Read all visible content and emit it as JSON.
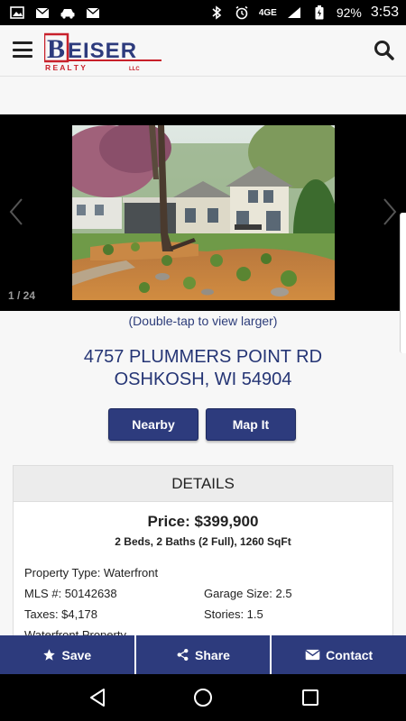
{
  "status_bar": {
    "network_label": "4GE",
    "battery_percent": "92%",
    "time": "3:53"
  },
  "header": {
    "logo_main": "EISER",
    "logo_initial": "B",
    "logo_sub": "R E A L T Y",
    "logo_llc": "LLC"
  },
  "gallery": {
    "counter": "1 / 24",
    "double_tap_hint": "(Double-tap to view larger)"
  },
  "address": {
    "line1": "4757 PLUMMERS POINT RD",
    "line2": "OSHKOSH, WI 54904"
  },
  "buttons": {
    "nearby": "Nearby",
    "map_it": "Map It"
  },
  "details": {
    "title": "DETAILS",
    "price": "Price: $399,900",
    "summary": "2 Beds, 2 Baths (2 Full), 1260 SqFt",
    "property_type": "Property Type: Waterfront",
    "mls": "MLS #: 50142638",
    "garage": "Garage Size: 2.5",
    "taxes": "Taxes: $4,178",
    "stories": "Stories: 1.5",
    "extra": "Waterfront Property"
  },
  "actions": {
    "save": "Save",
    "share": "Share",
    "contact": "Contact"
  },
  "colors": {
    "brand_blue": "#2d3b7d",
    "logo_red": "#c8202a"
  }
}
